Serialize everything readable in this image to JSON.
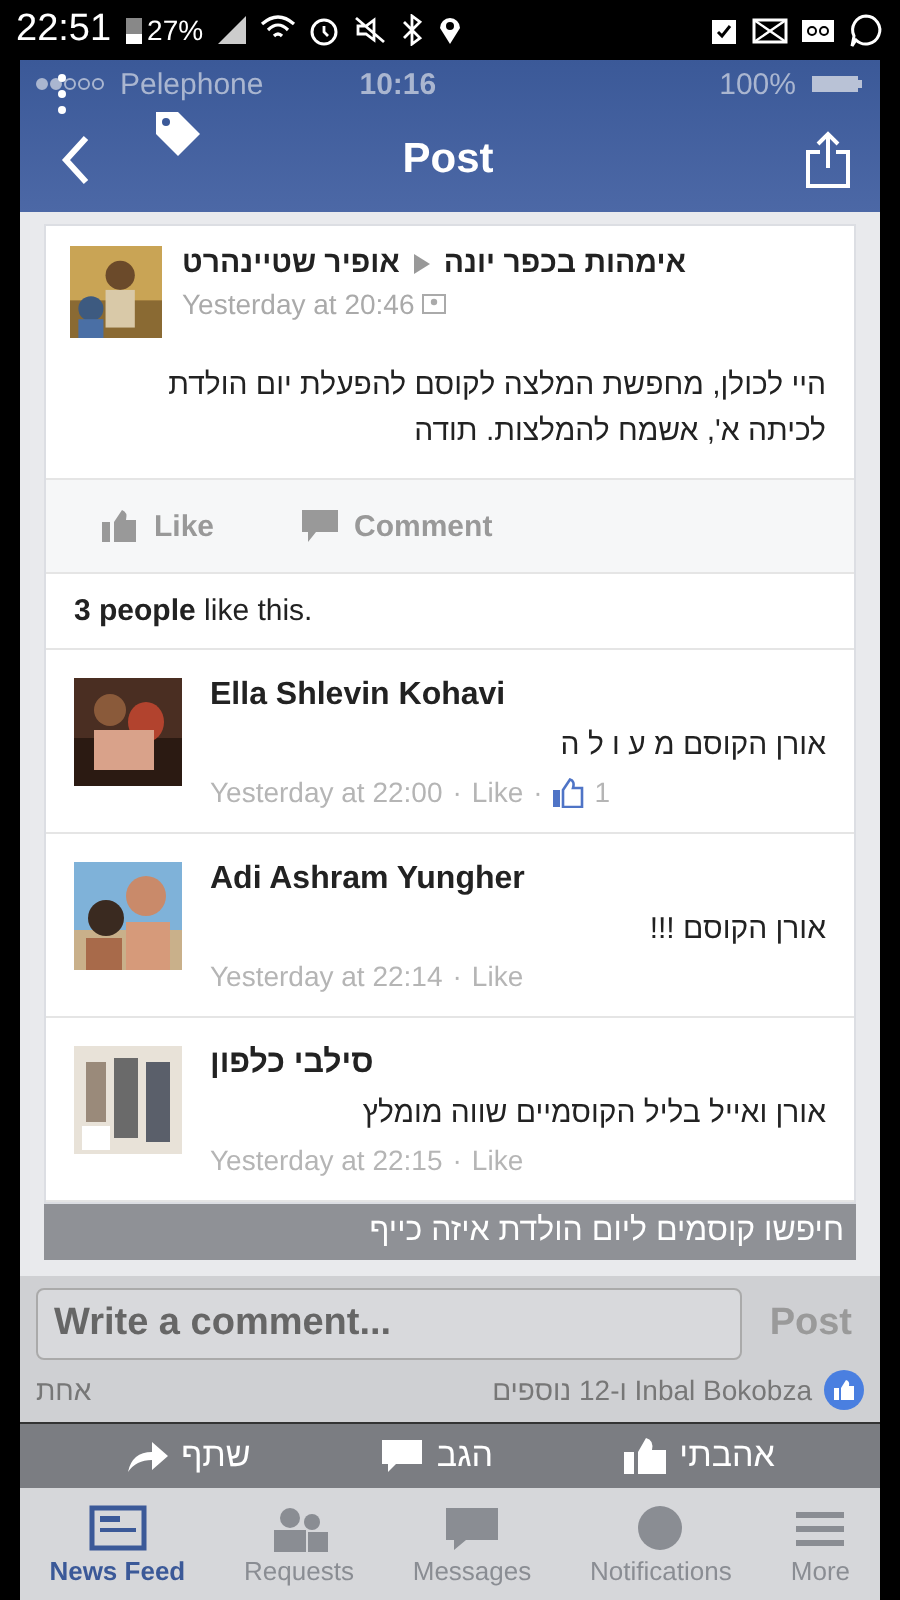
{
  "android_status": {
    "time": "22:51",
    "battery": "27%"
  },
  "ios_status": {
    "carrier": "Pelephone",
    "time": "10:16",
    "battery": "100%"
  },
  "nav": {
    "title": "Post"
  },
  "post": {
    "author": "אופיר שטיינהרט",
    "group": "אימהות בכפר יונה",
    "time": "Yesterday at 20:46",
    "text": "היי לכולן, מחפשת המלצה לקוסם להפעלת יום הולדת לכיתה א', אשמח להמלצות. תודה",
    "like_action": "Like",
    "comment_action": "Comment",
    "likes": "**3 people** like this."
  },
  "comments": [
    {
      "name": "Ella Shlevin Kohavi",
      "text": "אורן הקוסם מ ע ו ל ה",
      "time": "Yesterday at 22:00",
      "separator": "·",
      "like": "Like",
      "count_separator": "·",
      "like_count": "1"
    },
    {
      "name": "Adi Ashram Yungher",
      "text": "אורן הקוסם !!!",
      "time": "Yesterday at 22:14",
      "separator": "·",
      "like": "Like"
    },
    {
      "name": "סילבי כלפון",
      "text": "אורן ואייל בליל הקוסמיים שווה מומלץ",
      "time": "Yesterday at 22:15",
      "separator": "·",
      "like": "Like"
    }
  ],
  "caption": "חיפשו קוסמים ליום הולדת איזה כייף",
  "composer": {
    "placeholder": "Write a comment...",
    "button": "Post"
  },
  "reactions": {
    "summary": "Inbal Bokobza ו-12 נוספים",
    "comments": "אחת"
  },
  "share_actions": [
    {
      "kind": "like",
      "label": "אהבתי"
    },
    {
      "kind": "comment",
      "label": "הגב"
    },
    {
      "kind": "share",
      "label": "שתף"
    }
  ],
  "tabs": {
    "feed": {
      "label": "News Feed",
      "selected": true
    },
    "requests": {
      "label": "Requests",
      "selected": false
    },
    "messages": {
      "label": "Messages",
      "selected": false
    },
    "notifications": {
      "label": "Notifications",
      "selected": false
    },
    "more": {
      "label": "More",
      "selected": false
    }
  }
}
